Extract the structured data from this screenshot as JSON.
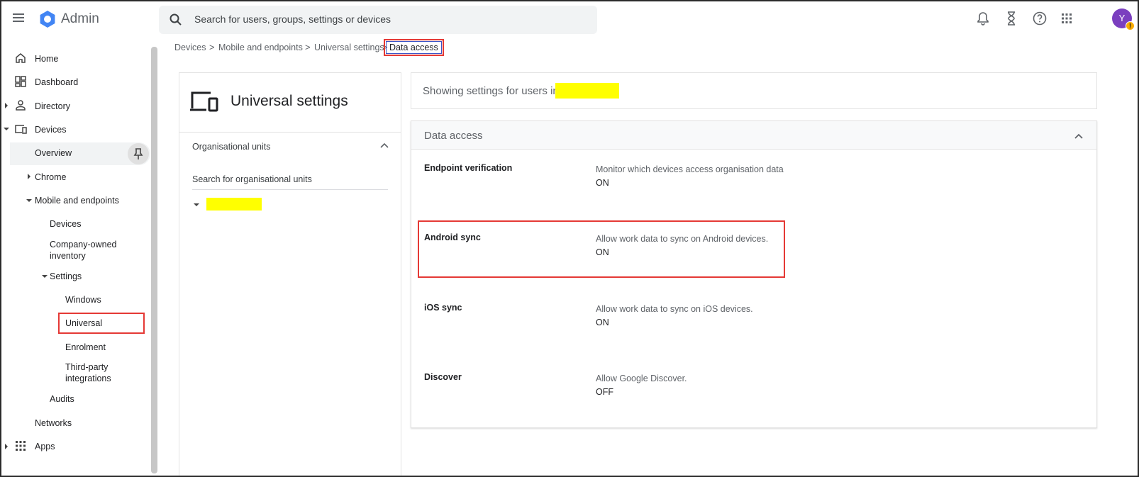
{
  "app": {
    "name": "Admin"
  },
  "search": {
    "placeholder": "Search for users, groups, settings or devices"
  },
  "topbar": {
    "icons": [
      "bell-icon",
      "hourglass-icon",
      "help-icon",
      "apps-grid-icon"
    ],
    "avatar_initial": "Y",
    "avatar_color": "#7b3fbf",
    "warning_badge": "!"
  },
  "sidebar": {
    "home": "Home",
    "dashboard": "Dashboard",
    "directory": "Directory",
    "devices": "Devices",
    "overview": "Overview",
    "chrome": "Chrome",
    "mobile": "Mobile and endpoints",
    "sub_devices": "Devices",
    "company_owned": [
      "Company-owned",
      "inventory"
    ],
    "settings": "Settings",
    "windows": "Windows",
    "universal": "Universal",
    "enrolment": "Enrolment",
    "third_party": [
      "Third-party",
      "integrations"
    ],
    "audits": "Audits",
    "networks": "Networks",
    "apps": "Apps"
  },
  "breadcrumb": {
    "items": [
      "Devices",
      "Mobile and endpoints",
      "Universal settings"
    ],
    "separator": ">",
    "current": "Data access"
  },
  "ou_panel": {
    "title": "Universal settings",
    "section": "Organisational units",
    "search_label": "Search for organisational units"
  },
  "info_bar": {
    "text": "Showing settings for users in"
  },
  "data_access": {
    "title": "Data access",
    "rows": [
      {
        "label": "Endpoint verification",
        "description": "Monitor which devices access organisation data",
        "value": "ON"
      },
      {
        "label": "Android sync",
        "description": "Allow work data to sync on Android devices.",
        "value": "ON"
      },
      {
        "label": "iOS sync",
        "description": "Allow work data to sync on iOS devices.",
        "value": "ON"
      },
      {
        "label": "Discover",
        "description": "Allow Google Discover.",
        "value": "OFF"
      }
    ]
  },
  "colors": {
    "highlight_red": "#e53935",
    "redaction_yellow": "#ffff00",
    "breadcrumb_border": "#3a55c8"
  }
}
